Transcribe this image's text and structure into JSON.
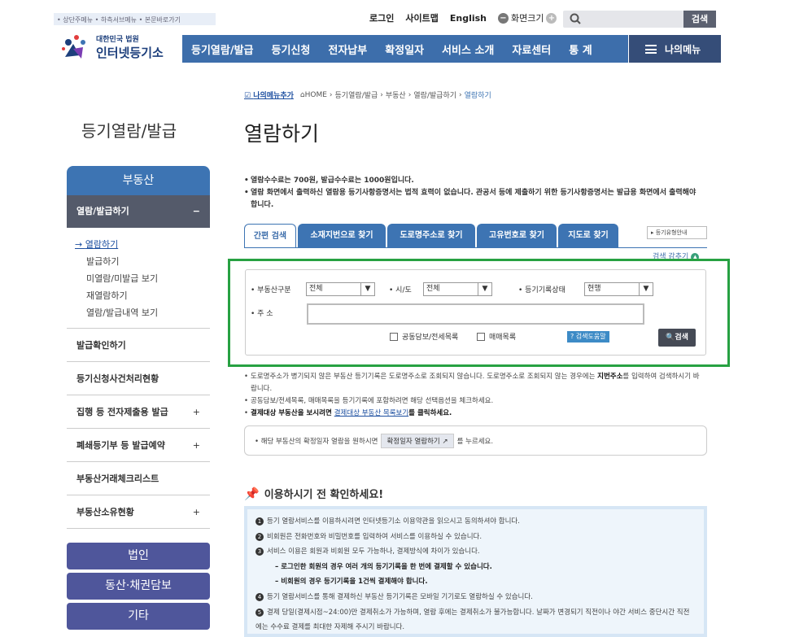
{
  "header": {
    "util_links": "• 상단주메뉴 • 하측서브메뉴 • 본문바로가기",
    "login": "로그인",
    "sitemap": "사이트맵",
    "english": "English",
    "screen_size": "화면크기",
    "search_button": "검색",
    "logo_sub": "대한민국 법원",
    "logo_main": "인터넷등기소"
  },
  "gnb": [
    "등기열람/발급",
    "등기신청",
    "전자납부",
    "확정일자",
    "서비스 소개",
    "자료센터",
    "통 계"
  ],
  "my_menu": "나의메뉴",
  "lnb": {
    "title": "등기열람/발급",
    "top": "부동산",
    "active": "열람/발급하기",
    "sub": [
      "열람하기",
      "발급하기",
      "미열람/미발급 보기",
      "재열람하기",
      "열람/발급내역 보기"
    ],
    "items": [
      {
        "label": "발급확인하기",
        "plus": ""
      },
      {
        "label": "등기신청사건처리현황",
        "plus": ""
      },
      {
        "label": "집행 등 전자제출용 발급",
        "plus": "+"
      },
      {
        "label": "폐쇄등기부 등 발급예약",
        "plus": "+"
      },
      {
        "label": "부동산거래체크리스트",
        "plus": ""
      },
      {
        "label": "부동산소유현황",
        "plus": "+"
      }
    ],
    "buttons": [
      "법인",
      "동산·채권담보",
      "기타"
    ]
  },
  "breadcrumb": {
    "add": "나의메뉴추가",
    "items": [
      "HOME",
      "등기열람/발급",
      "부동산",
      "열람/발급하기",
      "열람하기"
    ]
  },
  "page_title": "열람하기",
  "notice": [
    "열람수수료는 700원, 발급수수료는 1000원입니다.",
    "열람 화면에서 출력하신 열람용 등기사항증명서는 법적 효력이 없습니다. 관공서 등에 제출하기 위한 등기사항증명서는 발급용 화면에서 출력해야 합니다."
  ],
  "tabs": [
    "간편 검색",
    "소재지번으로 찾기",
    "도로명주소로 찾기",
    "고유번호로 찾기",
    "지도로 찾기"
  ],
  "guide_link": "▸ 등기유형안내",
  "hide_condition": "검색 감추기",
  "search": {
    "type_label": "• 부동산구분",
    "type_value": "전체",
    "city_label": "• 시/도",
    "city_value": "전체",
    "status_label": "• 등기기록상태",
    "status_value": "현행",
    "address_label": "• 주 소",
    "address_value": "",
    "check1": "공동담보/전세목록",
    "check2": "매매목록",
    "help": "검색도움말",
    "submit": "검색"
  },
  "desc": {
    "line1a": "도로명주소가 병기되지 않은 부동산 등기기록은 도로명주소로 조회되지 않습니다. 도로명주소로 조회되지 않는 경우에는 ",
    "line1b": "지번주소",
    "line1c": "를 입력하여 검색하시기 바랍니다.",
    "line2": "공동담보/전세목록, 매매목록을 등기기록에 포함하려면 해당 선택옵션을 체크하세요.",
    "line3a": "결제대상 부동산을 보시려면 ",
    "line3b": "결제대상 부동산 목록보기",
    "line3c": "를 클릭하세요."
  },
  "confirm": {
    "before": "• 해당 부동산의 확정일자 열람을 원하시면",
    "button": "확정일자 열람하기",
    "after": "를 누르세요."
  },
  "check_title": "이용하시기 전 확인하세요!",
  "check_items": [
    {
      "num": "1",
      "text": "등기 열람서비스를 이용하시려면 인터넷등기소 이용약관을 읽으시고 동의하셔야 합니다."
    },
    {
      "num": "2",
      "text": "비회원은 전화번호와 비밀번호를 입력하여 서비스를 이용하실 수 있습니다."
    },
    {
      "num": "3",
      "text": "서비스 이용은 회원과 비회원 모두 가능하나, 결제방식에 차이가 있습니다."
    },
    {
      "num": "",
      "text": "– 로그인한 회원의 경우 여러 개의 등기기록을 한 번에 결제할 수 있습니다."
    },
    {
      "num": "",
      "text": "– 비회원의 경우 등기기록을 1건씩 결제해야 합니다."
    },
    {
      "num": "4",
      "text": "등기 열람서비스를 통해 결제하신 부동산 등기기록은 모바일 기기로도 열람하실 수 있습니다."
    },
    {
      "num": "5",
      "text": "결제 당일(결제시점~24:00)만 결제취소가 가능하며, 열람 후에는 결제취소가 불가능합니다. 날짜가 변경되기 직전이나 야간 서비스 중단시간 직전에는 수수료 결제를 최대한 자제해 주시기 바랍니다."
    }
  ]
}
